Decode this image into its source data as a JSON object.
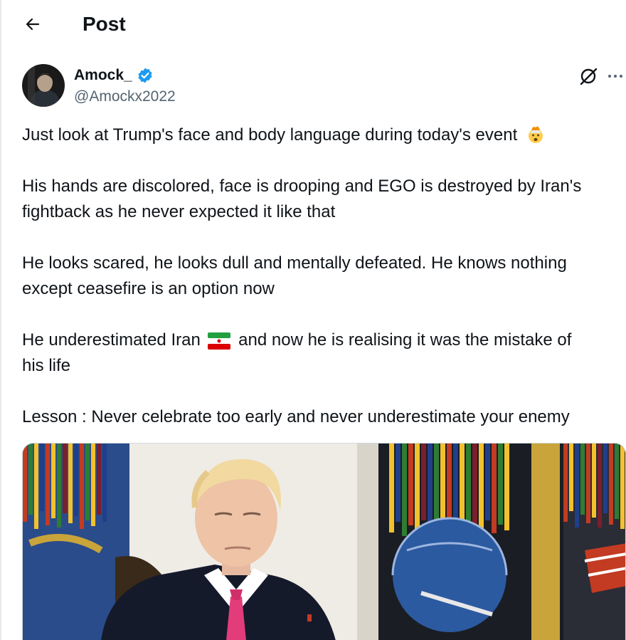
{
  "header": {
    "title": "Post",
    "back_icon": "arrow-left-icon"
  },
  "author": {
    "display_name": "Amock_",
    "handle": "@Amockx2022",
    "verified": true,
    "verified_color": "#1d9bf0"
  },
  "actions": {
    "grok_icon": "grok-icon",
    "more_icon": "more-horizontal-icon"
  },
  "tweet": {
    "paragraphs": [
      [
        "Just look at Trump's face and body language during today's event"
      ],
      [
        "His hands are discolored, face is drooping and EGO is destroyed by Iran's",
        "fightback as he never expected it like that"
      ],
      [
        "He looks scared, he looks dull and mentally defeated. He knows nothing",
        "except ceasefire is an option now"
      ],
      [
        "He underestimated Iran",
        "and now he is realising it was the mistake of",
        "his life"
      ],
      [
        "Lesson : Never celebrate too early and never underestimate your enemy"
      ]
    ],
    "emoji_1": "exploding-head-emoji",
    "emoji_2": "iran-flag-emoji"
  },
  "media": {
    "type": "video-still",
    "subject": "man in dark suit and pink tie in front of military flags"
  },
  "colors": {
    "text": "#0f1419",
    "secondary": "#536471",
    "accent": "#1d9bf0"
  }
}
